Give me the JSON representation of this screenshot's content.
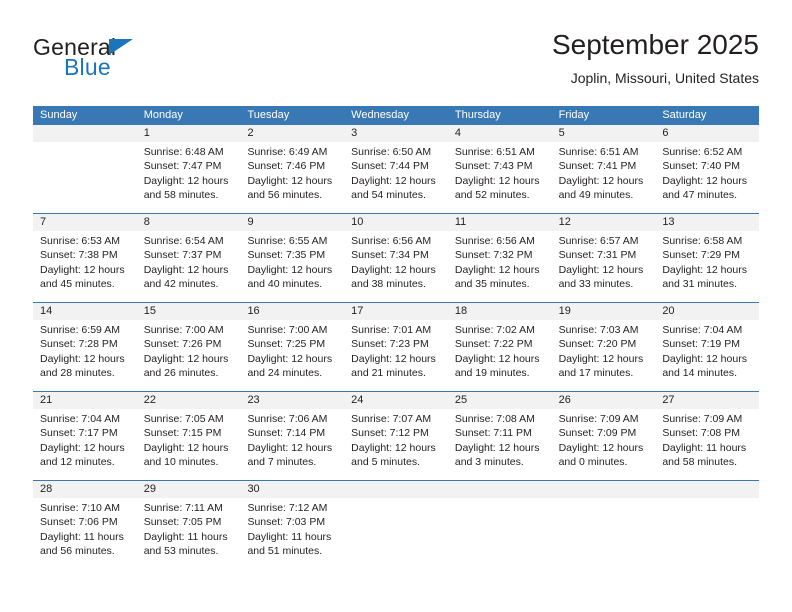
{
  "brand": {
    "name_part1": "General",
    "name_part2": "Blue",
    "accent_color": "#1b75bb",
    "triangle_icon": "triangle-icon"
  },
  "header": {
    "month_title": "September 2025",
    "location": "Joplin, Missouri, United States"
  },
  "calendar": {
    "header_bg": "#3878b4",
    "daynum_bg": "#f2f2f2",
    "weekdays": [
      "Sunday",
      "Monday",
      "Tuesday",
      "Wednesday",
      "Thursday",
      "Friday",
      "Saturday"
    ],
    "weeks": [
      [
        {
          "day": "",
          "lines": []
        },
        {
          "day": "1",
          "lines": [
            "Sunrise: 6:48 AM",
            "Sunset: 7:47 PM",
            "Daylight: 12 hours",
            "and 58 minutes."
          ]
        },
        {
          "day": "2",
          "lines": [
            "Sunrise: 6:49 AM",
            "Sunset: 7:46 PM",
            "Daylight: 12 hours",
            "and 56 minutes."
          ]
        },
        {
          "day": "3",
          "lines": [
            "Sunrise: 6:50 AM",
            "Sunset: 7:44 PM",
            "Daylight: 12 hours",
            "and 54 minutes."
          ]
        },
        {
          "day": "4",
          "lines": [
            "Sunrise: 6:51 AM",
            "Sunset: 7:43 PM",
            "Daylight: 12 hours",
            "and 52 minutes."
          ]
        },
        {
          "day": "5",
          "lines": [
            "Sunrise: 6:51 AM",
            "Sunset: 7:41 PM",
            "Daylight: 12 hours",
            "and 49 minutes."
          ]
        },
        {
          "day": "6",
          "lines": [
            "Sunrise: 6:52 AM",
            "Sunset: 7:40 PM",
            "Daylight: 12 hours",
            "and 47 minutes."
          ]
        }
      ],
      [
        {
          "day": "7",
          "lines": [
            "Sunrise: 6:53 AM",
            "Sunset: 7:38 PM",
            "Daylight: 12 hours",
            "and 45 minutes."
          ]
        },
        {
          "day": "8",
          "lines": [
            "Sunrise: 6:54 AM",
            "Sunset: 7:37 PM",
            "Daylight: 12 hours",
            "and 42 minutes."
          ]
        },
        {
          "day": "9",
          "lines": [
            "Sunrise: 6:55 AM",
            "Sunset: 7:35 PM",
            "Daylight: 12 hours",
            "and 40 minutes."
          ]
        },
        {
          "day": "10",
          "lines": [
            "Sunrise: 6:56 AM",
            "Sunset: 7:34 PM",
            "Daylight: 12 hours",
            "and 38 minutes."
          ]
        },
        {
          "day": "11",
          "lines": [
            "Sunrise: 6:56 AM",
            "Sunset: 7:32 PM",
            "Daylight: 12 hours",
            "and 35 minutes."
          ]
        },
        {
          "day": "12",
          "lines": [
            "Sunrise: 6:57 AM",
            "Sunset: 7:31 PM",
            "Daylight: 12 hours",
            "and 33 minutes."
          ]
        },
        {
          "day": "13",
          "lines": [
            "Sunrise: 6:58 AM",
            "Sunset: 7:29 PM",
            "Daylight: 12 hours",
            "and 31 minutes."
          ]
        }
      ],
      [
        {
          "day": "14",
          "lines": [
            "Sunrise: 6:59 AM",
            "Sunset: 7:28 PM",
            "Daylight: 12 hours",
            "and 28 minutes."
          ]
        },
        {
          "day": "15",
          "lines": [
            "Sunrise: 7:00 AM",
            "Sunset: 7:26 PM",
            "Daylight: 12 hours",
            "and 26 minutes."
          ]
        },
        {
          "day": "16",
          "lines": [
            "Sunrise: 7:00 AM",
            "Sunset: 7:25 PM",
            "Daylight: 12 hours",
            "and 24 minutes."
          ]
        },
        {
          "day": "17",
          "lines": [
            "Sunrise: 7:01 AM",
            "Sunset: 7:23 PM",
            "Daylight: 12 hours",
            "and 21 minutes."
          ]
        },
        {
          "day": "18",
          "lines": [
            "Sunrise: 7:02 AM",
            "Sunset: 7:22 PM",
            "Daylight: 12 hours",
            "and 19 minutes."
          ]
        },
        {
          "day": "19",
          "lines": [
            "Sunrise: 7:03 AM",
            "Sunset: 7:20 PM",
            "Daylight: 12 hours",
            "and 17 minutes."
          ]
        },
        {
          "day": "20",
          "lines": [
            "Sunrise: 7:04 AM",
            "Sunset: 7:19 PM",
            "Daylight: 12 hours",
            "and 14 minutes."
          ]
        }
      ],
      [
        {
          "day": "21",
          "lines": [
            "Sunrise: 7:04 AM",
            "Sunset: 7:17 PM",
            "Daylight: 12 hours",
            "and 12 minutes."
          ]
        },
        {
          "day": "22",
          "lines": [
            "Sunrise: 7:05 AM",
            "Sunset: 7:15 PM",
            "Daylight: 12 hours",
            "and 10 minutes."
          ]
        },
        {
          "day": "23",
          "lines": [
            "Sunrise: 7:06 AM",
            "Sunset: 7:14 PM",
            "Daylight: 12 hours",
            "and 7 minutes."
          ]
        },
        {
          "day": "24",
          "lines": [
            "Sunrise: 7:07 AM",
            "Sunset: 7:12 PM",
            "Daylight: 12 hours",
            "and 5 minutes."
          ]
        },
        {
          "day": "25",
          "lines": [
            "Sunrise: 7:08 AM",
            "Sunset: 7:11 PM",
            "Daylight: 12 hours",
            "and 3 minutes."
          ]
        },
        {
          "day": "26",
          "lines": [
            "Sunrise: 7:09 AM",
            "Sunset: 7:09 PM",
            "Daylight: 12 hours",
            "and 0 minutes."
          ]
        },
        {
          "day": "27",
          "lines": [
            "Sunrise: 7:09 AM",
            "Sunset: 7:08 PM",
            "Daylight: 11 hours",
            "and 58 minutes."
          ]
        }
      ],
      [
        {
          "day": "28",
          "lines": [
            "Sunrise: 7:10 AM",
            "Sunset: 7:06 PM",
            "Daylight: 11 hours",
            "and 56 minutes."
          ]
        },
        {
          "day": "29",
          "lines": [
            "Sunrise: 7:11 AM",
            "Sunset: 7:05 PM",
            "Daylight: 11 hours",
            "and 53 minutes."
          ]
        },
        {
          "day": "30",
          "lines": [
            "Sunrise: 7:12 AM",
            "Sunset: 7:03 PM",
            "Daylight: 11 hours",
            "and 51 minutes."
          ]
        },
        {
          "day": "",
          "lines": []
        },
        {
          "day": "",
          "lines": []
        },
        {
          "day": "",
          "lines": []
        },
        {
          "day": "",
          "lines": []
        }
      ]
    ]
  }
}
